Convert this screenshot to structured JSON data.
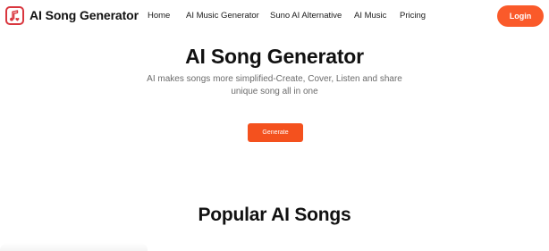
{
  "header": {
    "logo_text": "AI Song Generator",
    "logo_icon": "music-note-heart-icon",
    "nav": [
      {
        "label": "Home"
      },
      {
        "label": "AI Music Generator"
      },
      {
        "label": "Suno AI Alternative"
      },
      {
        "label": "AI Music"
      },
      {
        "label": "Pricing"
      }
    ],
    "login_label": "Login"
  },
  "hero": {
    "title": "AI Song Generator",
    "subtitle": "AI makes songs more simplified-Create, Cover, Listen and share unique song all in one",
    "generate_label": "Generate"
  },
  "section": {
    "title": "Popular AI Songs"
  },
  "colors": {
    "accent": "#f4511e",
    "login": "#fa5a2a",
    "logo_border": "#d9363e"
  }
}
